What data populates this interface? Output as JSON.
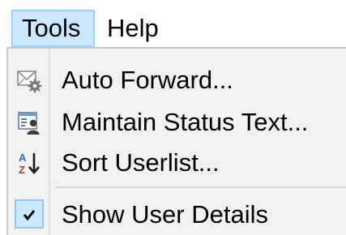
{
  "menubar": {
    "items": [
      {
        "label": "Tools"
      },
      {
        "label": "Help"
      }
    ]
  },
  "dropdown": {
    "items": [
      {
        "label": "Auto Forward...",
        "icon": "mail-gear-icon"
      },
      {
        "label": "Maintain Status Text...",
        "icon": "status-card-icon"
      },
      {
        "label": "Sort Userlist...",
        "icon": "sort-az-icon"
      },
      {
        "label": "Show User Details",
        "icon": "checkmark-icon",
        "checked": true
      }
    ]
  },
  "colors": {
    "menubar_highlight": "#cce8ff",
    "menubar_highlight_border": "#99d1ff",
    "dropdown_background": "#f2f2f2"
  }
}
